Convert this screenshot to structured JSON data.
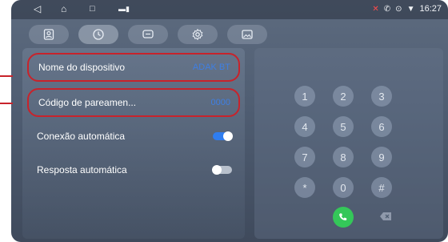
{
  "status_bar": {
    "time": "16:27"
  },
  "tabs": [
    {
      "icon": "contacts-icon"
    },
    {
      "icon": "clock-icon"
    },
    {
      "icon": "chat-icon"
    },
    {
      "icon": "gear-icon"
    },
    {
      "icon": "image-icon"
    }
  ],
  "settings": {
    "device_name_label": "Nome do dispositivo",
    "device_name_value": "ADAK BT",
    "pairing_code_label": "Código de pareamen...",
    "pairing_code_value": "0000",
    "auto_connect_label": "Conexão automática",
    "auto_connect_on": true,
    "auto_answer_label": "Resposta automática",
    "auto_answer_on": false
  },
  "keypad": {
    "keys": [
      "1",
      "2",
      "3",
      "4",
      "5",
      "6",
      "7",
      "8",
      "9",
      "*",
      "0",
      "#"
    ]
  },
  "colors": {
    "accent": "#2f7df0",
    "highlight": "#c8232b",
    "call": "#34c759"
  }
}
